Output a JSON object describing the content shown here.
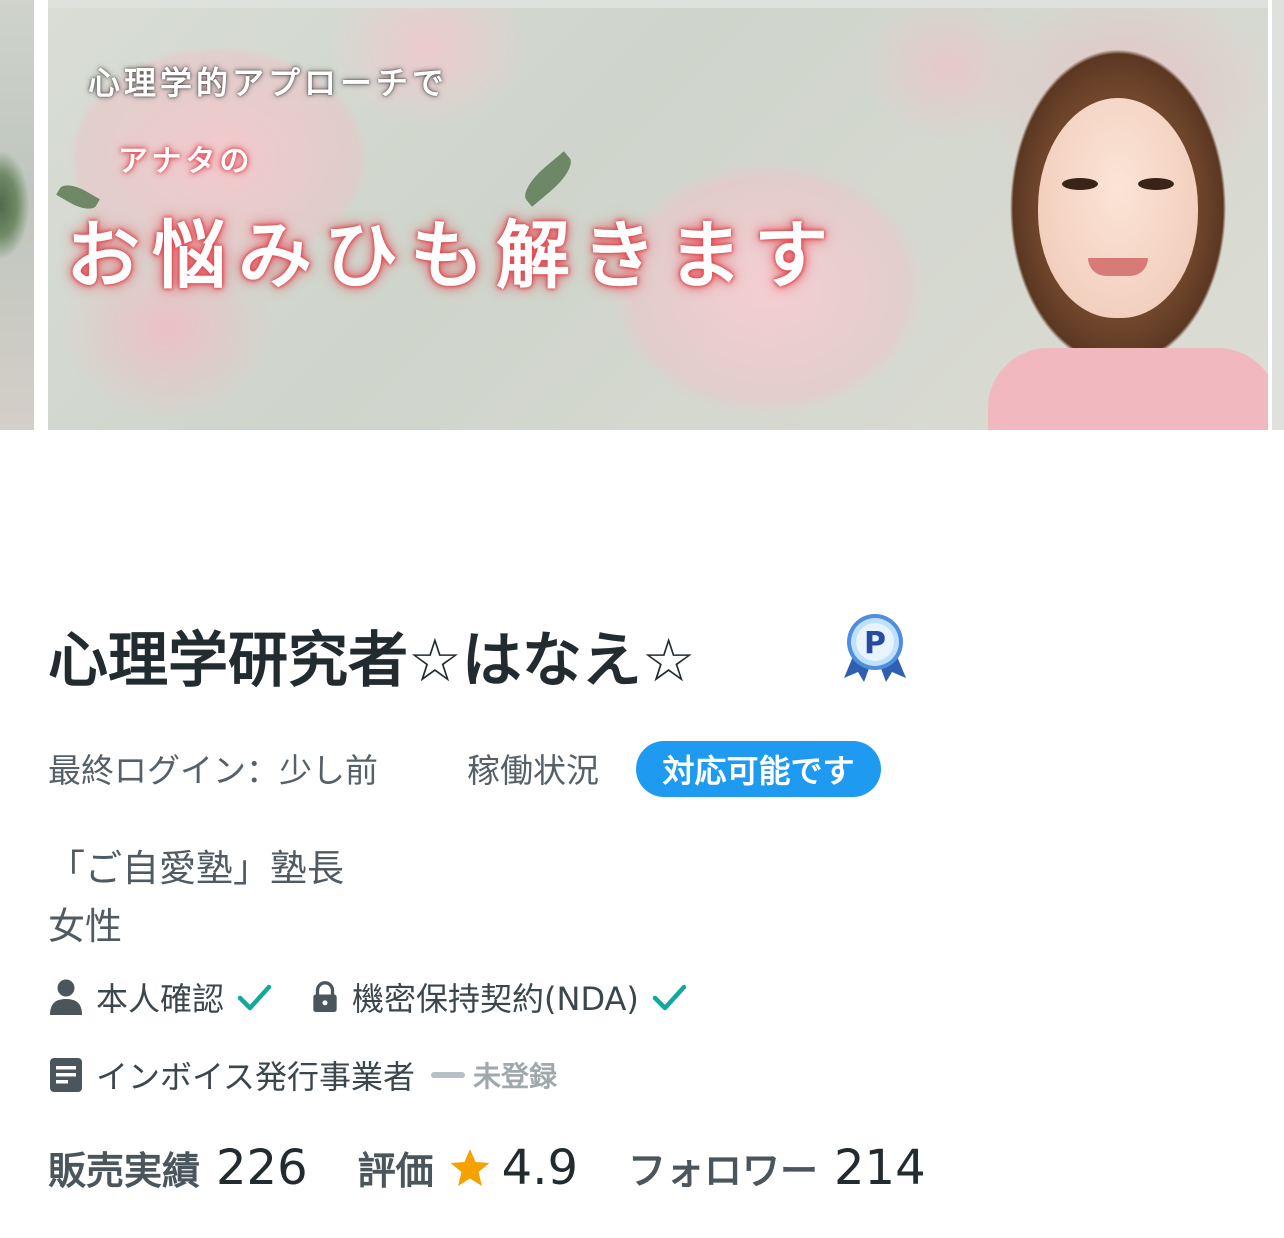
{
  "banner": {
    "line1": "心理学的アプローチで",
    "line2": "アナタの",
    "line3": "お悩みひも解きます"
  },
  "profile": {
    "name": "心理学研究者☆はなえ☆",
    "badge_letter": "P",
    "last_login": "最終ログイン：少し前",
    "status_label": "稼働状況",
    "status_value": "対応可能です",
    "bio_line1": "「ご自愛塾」塾長",
    "bio_line2": "女性"
  },
  "verification": {
    "identity": "本人確認",
    "nda": "機密保持契約(NDA)",
    "invoice": "インボイス発行事業者",
    "invoice_status": "未登録"
  },
  "stats": {
    "sales_label": "販売実績",
    "sales_value": "226",
    "rating_label": "評価",
    "rating_value": "4.9",
    "followers_label": "フォロワー",
    "followers_value": "214"
  },
  "colors": {
    "accent": "#1e9bf0",
    "check": "#13a89e",
    "star": "#f5a100",
    "banner_glow": "#e3474f"
  },
  "icons": [
    "person-icon",
    "lock-icon",
    "document-icon",
    "check-icon",
    "star-icon",
    "pro-badge-icon"
  ]
}
